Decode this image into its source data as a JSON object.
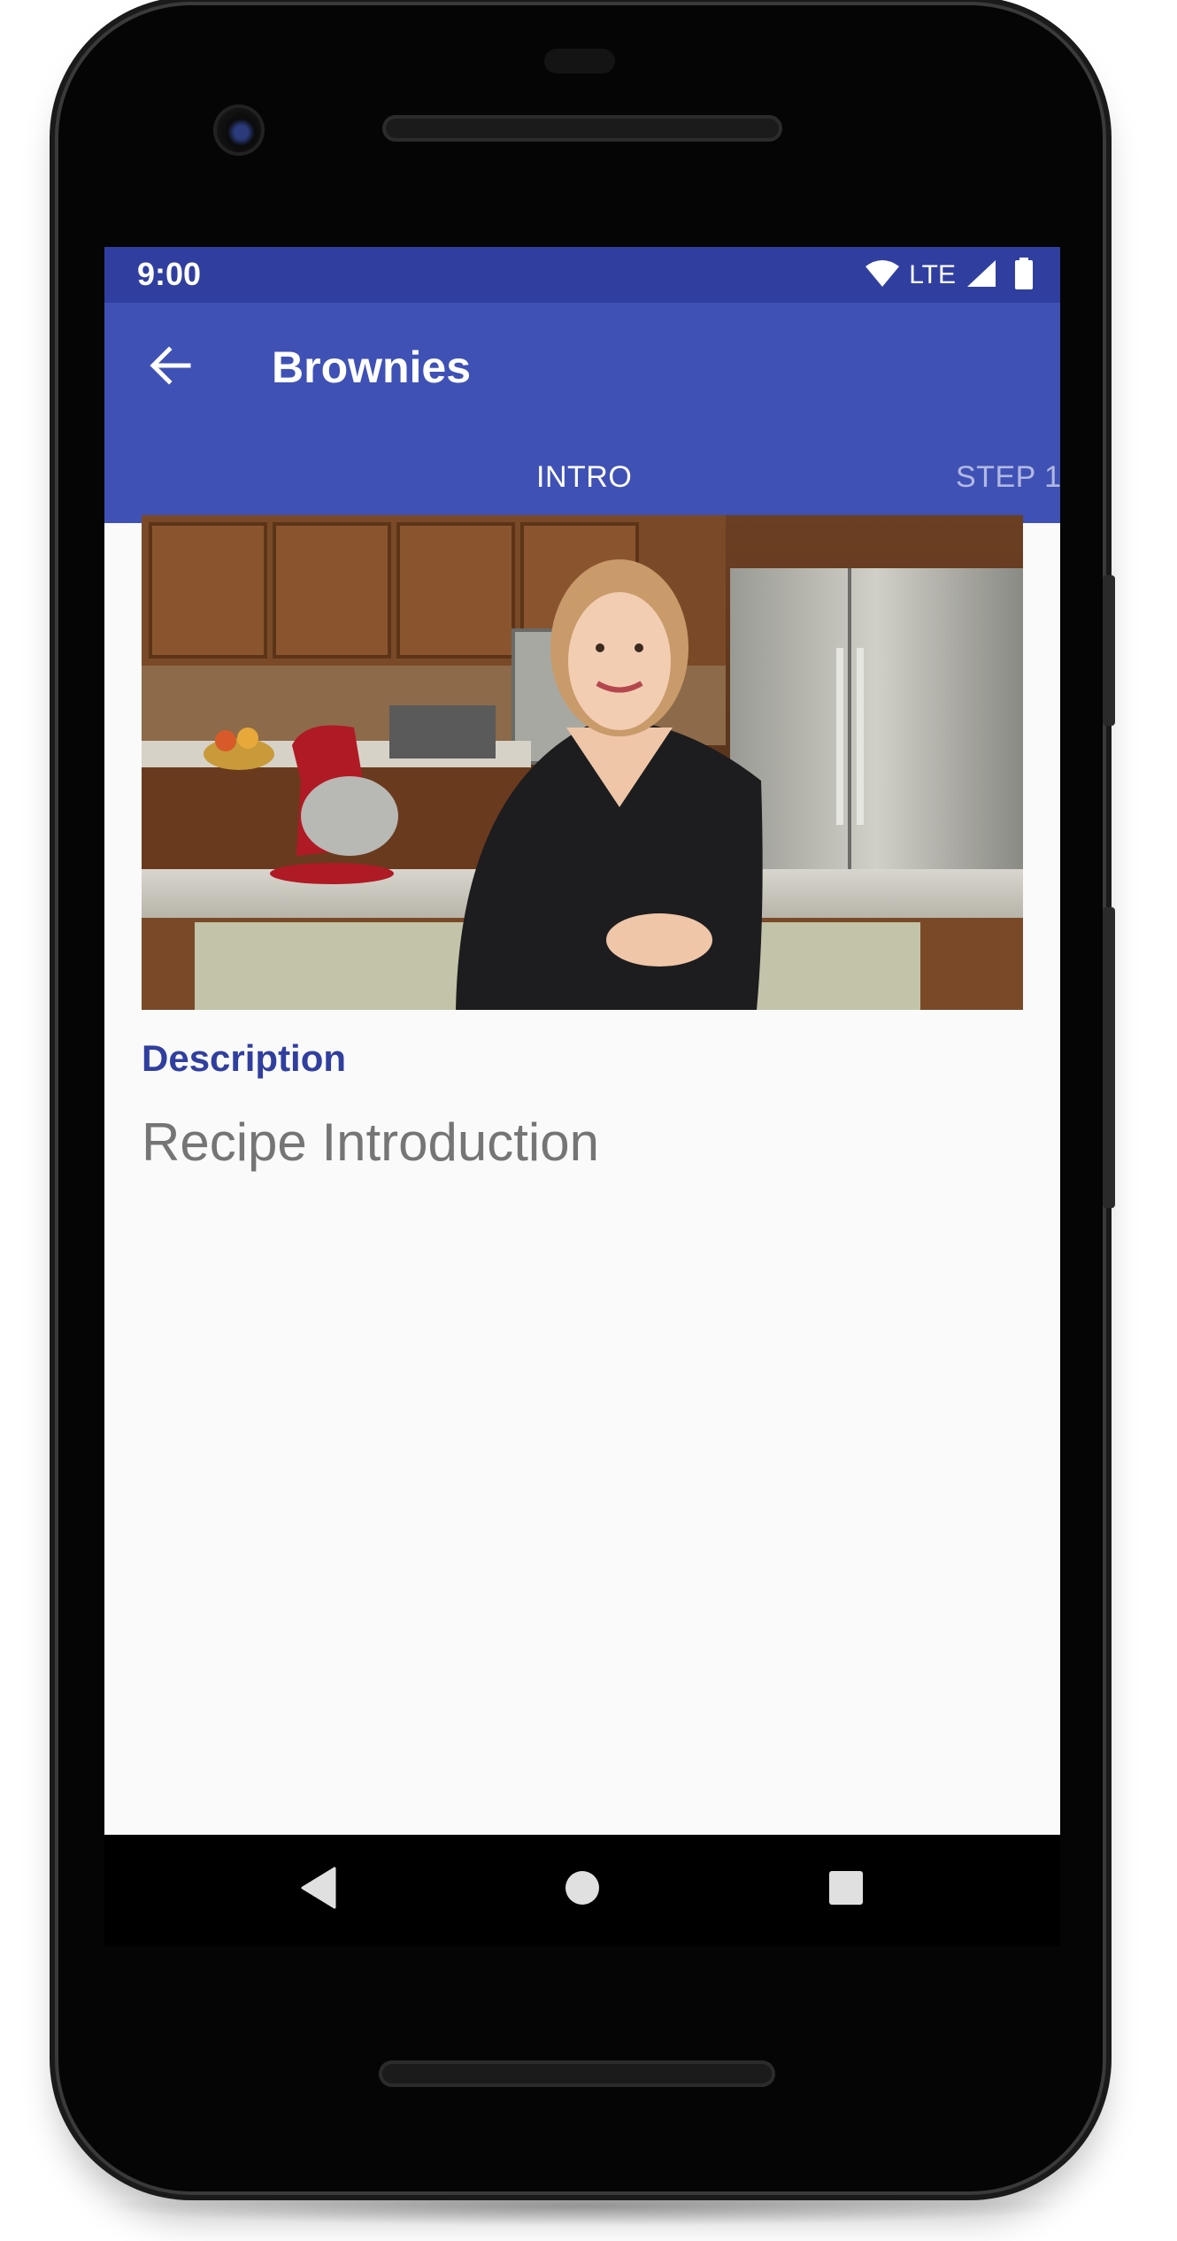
{
  "status_bar": {
    "time": "9:00",
    "network": "LTE",
    "icons": [
      "wifi-icon",
      "signal-icon",
      "battery-icon"
    ]
  },
  "app_bar": {
    "title": "Brownies",
    "back_icon": "arrow-back-icon"
  },
  "tabs": [
    {
      "label": "INTRO",
      "selected": true
    },
    {
      "label": "STEP 1",
      "selected": false
    }
  ],
  "content": {
    "video_subject": "Recipe intro video",
    "description_label": "Description",
    "description_text": "Recipe Introduction"
  },
  "nav_bar": {
    "buttons": [
      "back-triangle-icon",
      "home-circle-icon",
      "recents-square-icon"
    ]
  },
  "colors": {
    "primary": "#3f51b5",
    "primary_dark": "#303f9f",
    "background": "#fafafa",
    "description_text": "#757575"
  }
}
